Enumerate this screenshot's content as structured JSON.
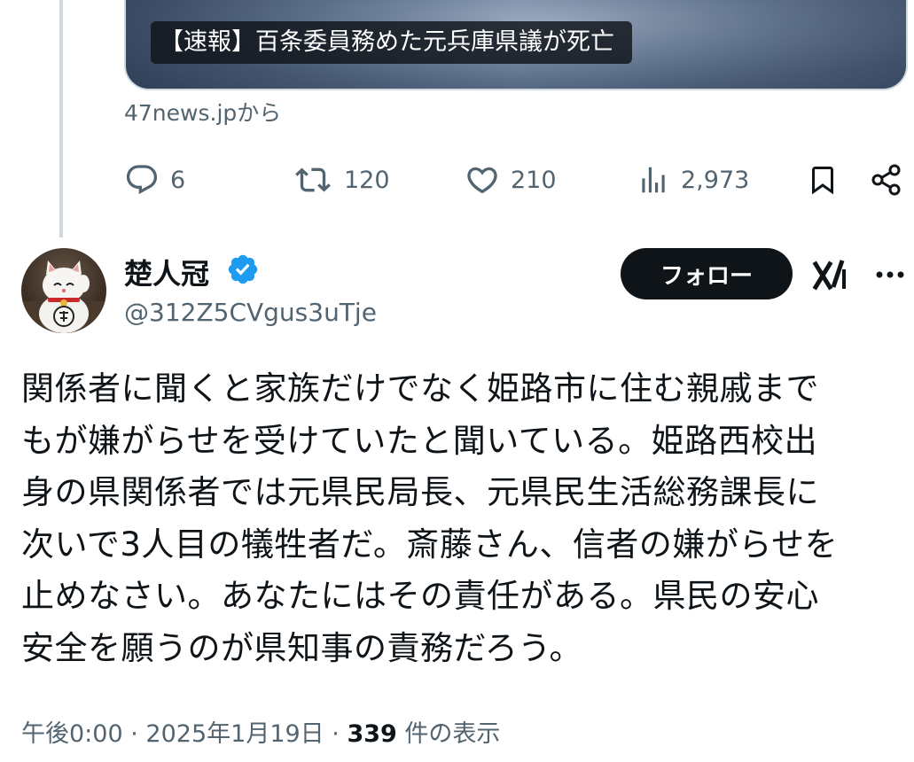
{
  "link_card": {
    "headline": "【速報】百条委員務めた元兵庫県議が死亡",
    "source": "47news.jpから"
  },
  "actions": {
    "reply_count": "6",
    "retweet_count": "120",
    "like_count": "210",
    "view_count": "2,973",
    "icons": [
      "reply-icon",
      "retweet-icon",
      "like-icon",
      "views-icon",
      "bookmark-icon",
      "share-icon"
    ]
  },
  "author": {
    "display_name": "楚人冠",
    "handle": "@312Z5CVgus3uTje",
    "verified": true,
    "verified_color": "#1d9bf0"
  },
  "follow_button": {
    "label": "フォロー"
  },
  "tweet": {
    "text": "関係者に聞くと家族だけでなく姫路市に住む親戚まで\nもが嫌がらせを受けていたと聞いている。姫路西校出\n身の県関係者では元県民局長、元県民生活総務課長に\n次いで3人目の犠牲者だ。斎藤さん、信者の嫌がらせを\n止めなさい。あなたにはその責任がある。県民の安心\n安全を願うのが県知事の責務だろう。"
  },
  "meta": {
    "time": "午後0:00",
    "separator": "·",
    "date": "2025年1月19日",
    "views_count": "339",
    "views_label": "件の表示"
  },
  "colors": {
    "text_primary": "#0f1419",
    "text_secondary": "#536471",
    "border": "#cfd9de",
    "accent": "#1d9bf0"
  }
}
